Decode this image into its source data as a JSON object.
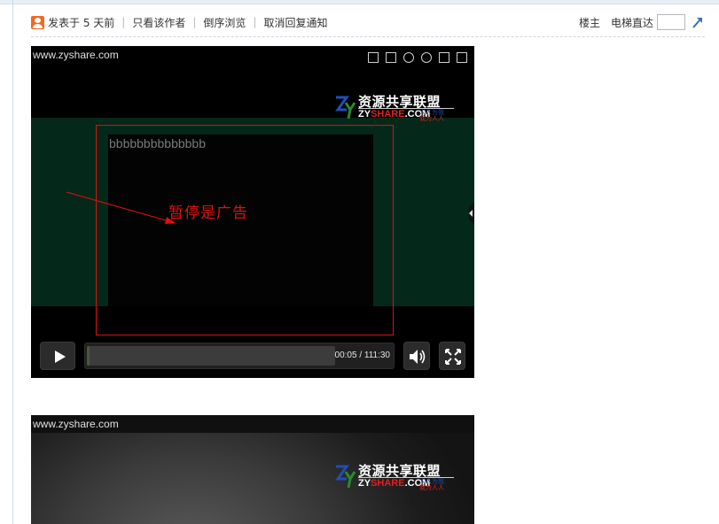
{
  "post_bar": {
    "posted": "发表于 5 天前",
    "only_author": "只看该作者",
    "reverse": "倒序浏览",
    "cancel_notify": "取消回复通知",
    "floor_owner": "楼主",
    "elevator": "电梯直达",
    "elevator_value": ""
  },
  "player1": {
    "site": "www.zyshare.com",
    "placeholder_text": "bbbbbbbbbbbbbb",
    "annotation": "暂停是广告",
    "time": "00:05 / 111:30",
    "progress_fraction": 0.0008
  },
  "logo": {
    "cn": "资源共享联盟",
    "en_a": "ZY",
    "en_b": "SHARE",
    "en_c": ".COM",
    "tag1": "人人为我",
    "tag2": "我为人人"
  },
  "player2": {
    "site": "www.zyshare.com"
  },
  "colors": {
    "annotation": "#e01010",
    "accent_orange": "#f26a21",
    "video_band": "#042819"
  }
}
